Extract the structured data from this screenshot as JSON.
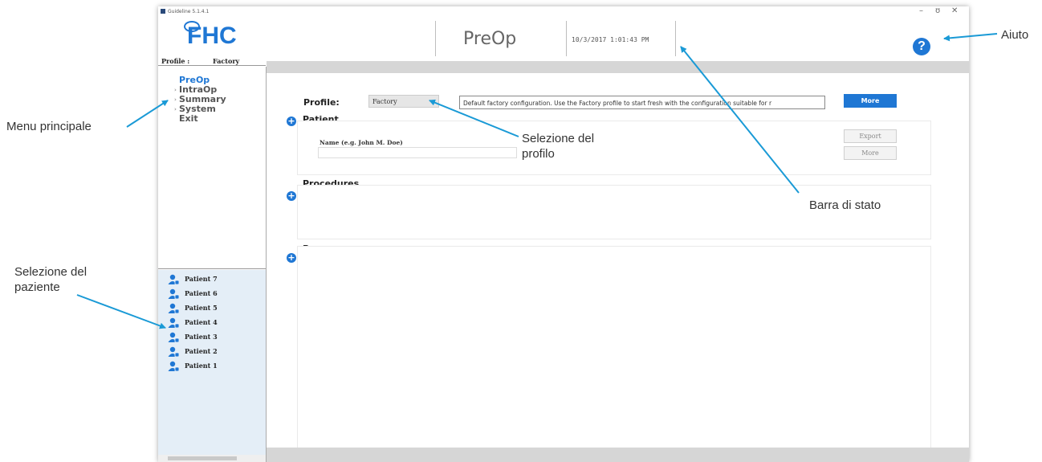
{
  "window": {
    "title": "Guideline 5.1.4.1",
    "controls": {
      "minimize": "–",
      "maximize": "ʊ",
      "close": "✕"
    }
  },
  "header": {
    "logo_text": "FHC",
    "page_name": "PreOp",
    "status_time": "10/3/2017 1:01:43 PM",
    "help_label": "?"
  },
  "profile_bar": {
    "label": "Profile :",
    "value": "Factory"
  },
  "menu": {
    "items": [
      {
        "label": "PreOp",
        "active": true
      },
      {
        "label": "IntraOp",
        "active": false
      },
      {
        "label": "Summary",
        "active": false
      },
      {
        "label": "System",
        "active": false
      },
      {
        "label": "Exit",
        "active": false
      }
    ]
  },
  "patients": [
    "Patient 7",
    "Patient 6",
    "Patient 5",
    "Patient 4",
    "Patient 3",
    "Patient 2",
    "Patient 1"
  ],
  "content": {
    "profile_label": "Profile:",
    "profile_value": "Factory",
    "profile_description": "Default factory configuration. Use the Factory profile to start fresh with the configuration suitable for r",
    "more_label": "More",
    "patient_section": "Patient",
    "name_label": "Name (e.g. John M. Doe)",
    "name_value": "",
    "export_label": "Export",
    "patient_more_label": "More",
    "procedures_section": "Procedures",
    "passes_section": "Passes"
  },
  "callouts": {
    "aiuto": "Aiuto",
    "menu_principale": "Menu principale",
    "selezione_profilo": "Selezione del profilo",
    "barra_di_stato": "Barra di stato",
    "selezione_paziente": "Selezione del paziente"
  },
  "colors": {
    "accent": "#1f77d4",
    "patient_panel": "#e4eef7",
    "callout_arrow": "#1a9ad6"
  }
}
